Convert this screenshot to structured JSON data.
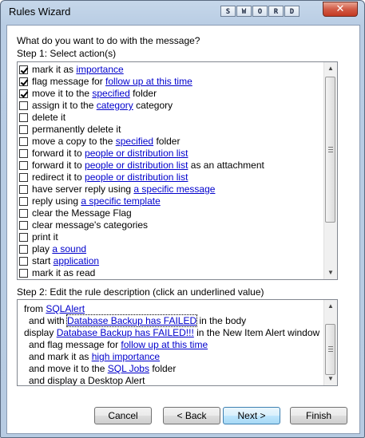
{
  "window": {
    "title": "Rules Wizard",
    "close_glyph": "✕",
    "sword_buttons": [
      "S",
      "W",
      "O",
      "R",
      "D"
    ]
  },
  "question": "What do you want to do with the message?",
  "step1": {
    "label": "Step 1: Select action(s)",
    "actions": [
      {
        "checked": true,
        "parts": [
          {
            "t": "mark it as "
          },
          {
            "t": "importance",
            "link": true
          }
        ]
      },
      {
        "checked": true,
        "parts": [
          {
            "t": "flag message for "
          },
          {
            "t": "follow up at this time",
            "link": true
          }
        ]
      },
      {
        "checked": true,
        "parts": [
          {
            "t": "move it to the "
          },
          {
            "t": "specified",
            "link": true
          },
          {
            "t": " folder"
          }
        ]
      },
      {
        "checked": false,
        "parts": [
          {
            "t": "assign it to the "
          },
          {
            "t": "category",
            "link": true
          },
          {
            "t": " category"
          }
        ]
      },
      {
        "checked": false,
        "parts": [
          {
            "t": "delete it"
          }
        ]
      },
      {
        "checked": false,
        "parts": [
          {
            "t": "permanently delete it"
          }
        ]
      },
      {
        "checked": false,
        "parts": [
          {
            "t": "move a copy to the "
          },
          {
            "t": "specified",
            "link": true
          },
          {
            "t": " folder"
          }
        ]
      },
      {
        "checked": false,
        "parts": [
          {
            "t": "forward it to "
          },
          {
            "t": "people or distribution list",
            "link": true
          }
        ]
      },
      {
        "checked": false,
        "parts": [
          {
            "t": "forward it to "
          },
          {
            "t": "people or distribution list",
            "link": true
          },
          {
            "t": " as an attachment"
          }
        ]
      },
      {
        "checked": false,
        "parts": [
          {
            "t": "redirect it to "
          },
          {
            "t": "people or distribution list",
            "link": true
          }
        ]
      },
      {
        "checked": false,
        "parts": [
          {
            "t": "have server reply using "
          },
          {
            "t": "a specific message",
            "link": true
          }
        ]
      },
      {
        "checked": false,
        "parts": [
          {
            "t": "reply using "
          },
          {
            "t": "a specific template",
            "link": true
          }
        ]
      },
      {
        "checked": false,
        "parts": [
          {
            "t": "clear the Message Flag"
          }
        ]
      },
      {
        "checked": false,
        "parts": [
          {
            "t": "clear message's categories"
          }
        ]
      },
      {
        "checked": false,
        "parts": [
          {
            "t": "print it"
          }
        ]
      },
      {
        "checked": false,
        "parts": [
          {
            "t": "play "
          },
          {
            "t": "a sound",
            "link": true
          }
        ]
      },
      {
        "checked": false,
        "parts": [
          {
            "t": "start "
          },
          {
            "t": "application",
            "link": true
          }
        ]
      },
      {
        "checked": false,
        "parts": [
          {
            "t": "mark it as read"
          }
        ]
      }
    ]
  },
  "step2": {
    "label": "Step 2: Edit the rule description (click an underlined value)",
    "lines": [
      {
        "indent": 0,
        "parts": [
          {
            "t": "from "
          },
          {
            "t": "SQLAlert",
            "link": true
          }
        ]
      },
      {
        "indent": 1,
        "parts": [
          {
            "t": "and with "
          },
          {
            "t": "Database Backup has FAILED",
            "link": true,
            "focus": true
          },
          {
            "t": " in the body"
          }
        ]
      },
      {
        "indent": 0,
        "parts": [
          {
            "t": "display "
          },
          {
            "t": "Database Backup has FAILED!!!",
            "link": true
          },
          {
            "t": " in the New Item Alert window"
          }
        ]
      },
      {
        "indent": 1,
        "parts": [
          {
            "t": "and flag message for "
          },
          {
            "t": "follow up at this time",
            "link": true
          }
        ]
      },
      {
        "indent": 1,
        "parts": [
          {
            "t": "and mark it as "
          },
          {
            "t": "high importance",
            "link": true
          }
        ]
      },
      {
        "indent": 1,
        "parts": [
          {
            "t": "and move it to the "
          },
          {
            "t": "SQL Jobs",
            "link": true
          },
          {
            "t": " folder"
          }
        ]
      },
      {
        "indent": 1,
        "parts": [
          {
            "t": "and display a Desktop Alert"
          }
        ]
      }
    ]
  },
  "buttons": {
    "cancel": "Cancel",
    "back": "< Back",
    "next": "Next >",
    "finish": "Finish"
  }
}
